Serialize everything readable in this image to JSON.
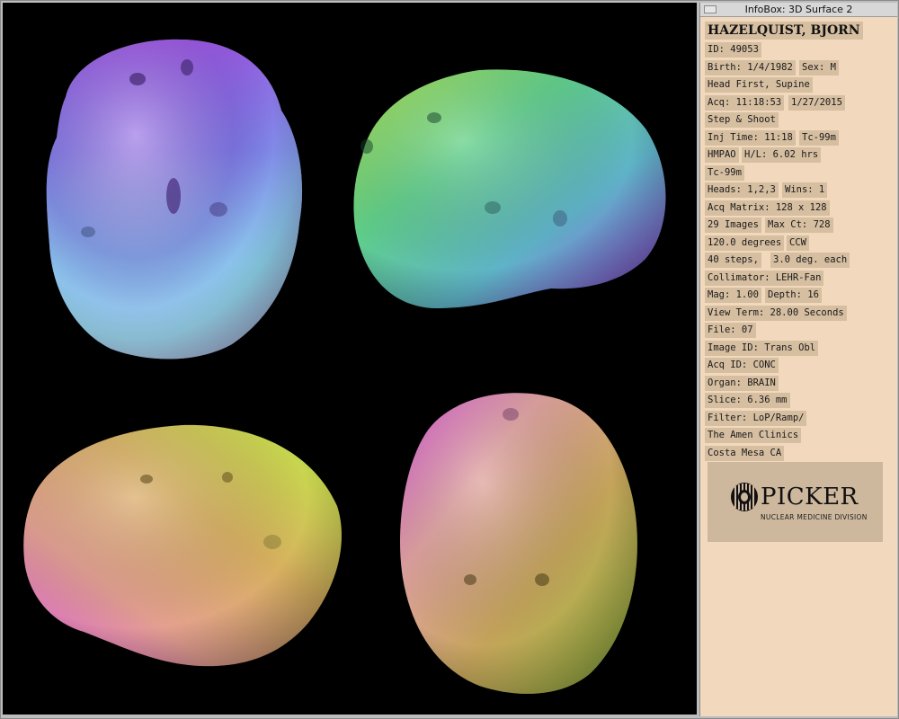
{
  "window": {
    "title": "InfoBox: 3D Surface 2"
  },
  "patient": {
    "name": "HAZELQUIST, BJORN"
  },
  "info_fields": [
    "ID: 49053",
    "Birth: 1/4/1982",
    "Sex: M",
    "Head First, Supine",
    "Acq: 11:18:53",
    "1/27/2015",
    "Step & Shoot",
    "Inj Time: 11:18",
    "Tc-99m",
    "HMPAO",
    "H/L: 6.02 hrs",
    "Tc-99m",
    "Heads: 1,2,3",
    "Wins: 1",
    "Acq Matrix: 128",
    "x 128",
    "29 Images",
    "Max Ct: 728",
    "120.0 degrees",
    "CCW",
    "40 steps,",
    "3.0 deg. each",
    "Collimator: LEHR-Fan",
    "Mag: 1.00",
    "Depth: 16",
    "View Term: 28.00 Seconds",
    "File: 07",
    "Image ID: Trans Obl",
    "Acq ID: CONC",
    "Organ: BRAIN",
    "Slice: 6.36 mm",
    "Filter: LoP/Ramp/",
    "The Amen Clinics",
    "Costa Mesa CA"
  ],
  "logo": {
    "name": "PICKER",
    "subtitle": "NUCLEAR MEDICINE DIVISION"
  },
  "colors": {
    "viewport_bg": "#000000",
    "infobox_bg": "#f2d9bd",
    "field_bg": "#d6bea1",
    "logo_box_bg": "#cdb79d"
  },
  "renders": [
    {
      "name": "brain-render-top",
      "palette": [
        "#9a4fe0",
        "#7d6fe8",
        "#9ad7f0",
        "#d9a8ea",
        "#c85ad8"
      ]
    },
    {
      "name": "brain-render-left",
      "palette": [
        "#6ec97a",
        "#9ee04a",
        "#7cc3b0",
        "#8a6fd8",
        "#b24fd0"
      ]
    },
    {
      "name": "brain-render-right",
      "palette": [
        "#d06ad8",
        "#e48a8a",
        "#d8b06a",
        "#c9d850",
        "#a6df6a"
      ]
    },
    {
      "name": "brain-render-bottom",
      "palette": [
        "#d86ad8",
        "#e0a0a0",
        "#c9a85a",
        "#b4b44a",
        "#86c45a"
      ]
    }
  ]
}
